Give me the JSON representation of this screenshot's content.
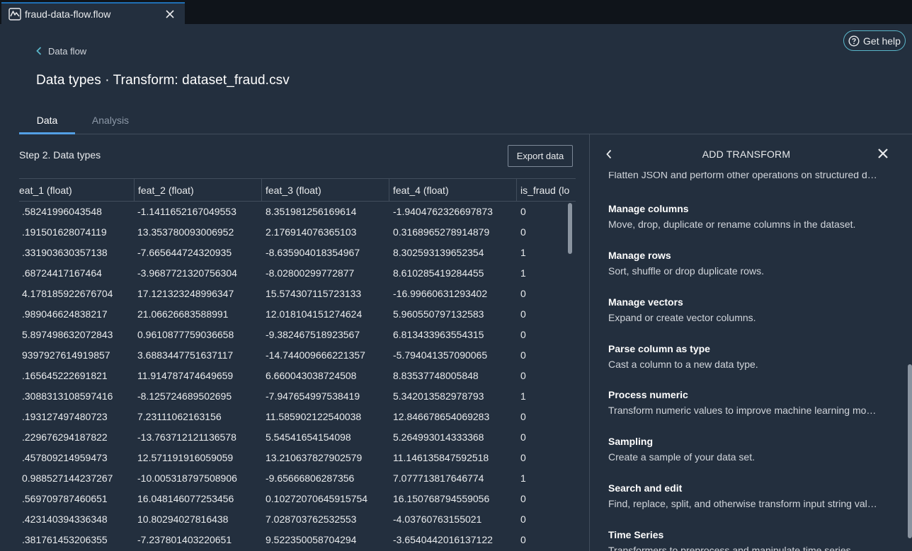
{
  "file_tab": {
    "name": "fraud-data-flow.flow"
  },
  "header": {
    "help_label": "Get help",
    "breadcrumb": "Data flow",
    "title": "Data types · Transform: dataset_fraud.csv"
  },
  "tabs": [
    {
      "label": "Data",
      "active": true
    },
    {
      "label": "Analysis",
      "active": false
    }
  ],
  "data_panel": {
    "step_label": "Step 2. Data types",
    "export_label": "Export data",
    "columns": [
      "eat_1 (float)",
      "feat_2 (float)",
      "feat_3 (float)",
      "feat_4 (float)",
      "is_fraud (lo"
    ],
    "rows": [
      [
        ".58241996043548",
        "-1.1411652167049553",
        "8.351981256169614",
        "-1.9404762326697873",
        "0"
      ],
      [
        ".191501628074119",
        "13.353780093006952",
        "2.176914076365103",
        "0.3168965278914879",
        "0"
      ],
      [
        ".331903630357138",
        "-7.665644724320935",
        "-8.635904018354967",
        "8.302593139652354",
        "1"
      ],
      [
        ".68724417167464",
        "-3.9687721320756304",
        "-8.02800299772877",
        "8.610285419284455",
        "1"
      ],
      [
        "4.178185922676704",
        "17.121323248996347",
        "15.574307115723133",
        "-16.99660631293402",
        "0"
      ],
      [
        ".989046624838217",
        "21.06626683588991",
        "12.018104151274624",
        "5.960550797132583",
        "0"
      ],
      [
        "5.897498632072843",
        "0.9610877759036658",
        "-9.382467518923567",
        "6.813433963554315",
        "0"
      ],
      [
        "9397927614919857",
        "3.6883447751637117",
        "-14.744009666221357",
        "-5.794041357090065",
        "0"
      ],
      [
        ".165645222691821",
        "11.914787474649659",
        "6.660043038724508",
        "8.83537748005848",
        "0"
      ],
      [
        ".3088313108597416",
        "-8.125724689502695",
        "-7.947654997538419",
        "5.342013582978793",
        "1"
      ],
      [
        ".193127497480723",
        "7.23111062163156",
        "11.585902122540038",
        "12.846678654069283",
        "0"
      ],
      [
        ".229676294187822",
        "-13.763712121136578",
        "5.54541654154098",
        "5.264993014333368",
        "0"
      ],
      [
        ".457809214959473",
        "12.571191916059059",
        "13.210637827902579",
        "11.146135847592518",
        "0"
      ],
      [
        "0.988527144237267",
        "-10.005318797508906",
        "-9.65666806287356",
        "7.077713817646774",
        "1"
      ],
      [
        ".569709787460651",
        "16.048146077253456",
        "0.10272070645915754",
        "16.150768794559056",
        "0"
      ],
      [
        ".423140394336348",
        "10.80294027816438",
        "7.028703762532553",
        "-4.03760763155021",
        "0"
      ],
      [
        ".381761453206355",
        "-7.237801403220651",
        "9.522350058704294",
        "-3.6540442016137122",
        "0"
      ]
    ]
  },
  "side_panel": {
    "title": "ADD TRANSFORM",
    "items": [
      {
        "title": "",
        "desc": "Flatten JSON and perform other operations on structured d…"
      },
      {
        "title": "Manage columns",
        "desc": "Move, drop, duplicate or rename columns in the dataset."
      },
      {
        "title": "Manage rows",
        "desc": "Sort, shuffle or drop duplicate rows."
      },
      {
        "title": "Manage vectors",
        "desc": "Expand or create vector columns."
      },
      {
        "title": "Parse column as type",
        "desc": "Cast a column to a new data type."
      },
      {
        "title": "Process numeric",
        "desc": "Transform numeric values to improve machine learning mo…"
      },
      {
        "title": "Sampling",
        "desc": "Create a sample of your data set."
      },
      {
        "title": "Search and edit",
        "desc": "Find, replace, split, and otherwise transform input string val…"
      },
      {
        "title": "Time Series",
        "desc": "Transformers to preprocess and manipulate time series"
      }
    ]
  },
  "colors": {
    "background": "#232f3e",
    "tab_strip": "#0f141a",
    "accent_blue": "#539fe5",
    "help_border": "#5ab6c9",
    "divider": "#414d5c"
  },
  "icons": {
    "file_tab": "sagemaker-flow-icon",
    "close": "close-icon",
    "help": "question-circle-icon",
    "back": "chevron-left-icon"
  }
}
